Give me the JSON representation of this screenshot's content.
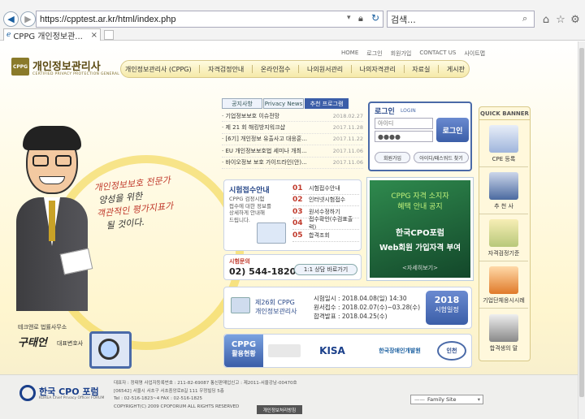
{
  "browser": {
    "url": "https://cpptest.ar.kr/html/index.php",
    "search_placeholder": "검색...",
    "tab_title": "CPPG 개인정보관..."
  },
  "header": {
    "logo_title": "개인정보관리사",
    "logo_sub": "CERTIFIED PRIVACY PROTECTION GENERAL",
    "logo_badge": "CPPG",
    "top_links": [
      "HOME",
      "로그인",
      "회원가입",
      "CONTACT US",
      "사이트맵"
    ],
    "gnb": [
      "개인정보관리사 (CPPG)",
      "자격검정안내",
      "온라인접수",
      "나의원서관리",
      "나의자격관리",
      "자료실",
      "게시판"
    ]
  },
  "news": {
    "tabs": [
      "공지사항",
      "Privacy News",
      "추천 프로그램"
    ],
    "items": [
      {
        "title": "· 기업정보보호 이슈전망",
        "date": "2018.02.27"
      },
      {
        "title": "· 제 21 회 해킹방지워크샵",
        "date": "2017.11.28"
      },
      {
        "title": "· [6기] 개인정보 유출사고 대응훈...",
        "date": "2017.11.22"
      },
      {
        "title": "· EU 개인정보보호법 세미나 개최...",
        "date": "2017.11.06"
      },
      {
        "title": "· 바이오정보 보호 가이드라인(안)...",
        "date": "2017.11.06"
      }
    ]
  },
  "login": {
    "title": "로그인",
    "title_en": "LOGIN",
    "id_placeholder": "아이디",
    "pw_value": "●●●●",
    "login_button": "로그인",
    "join_button": "회원가입",
    "find_button": "아이디/패스워드 찾기"
  },
  "quick": {
    "title": "QUICK BANNER",
    "items": [
      "CPE 등록",
      "추 천 사",
      "자격검정기준",
      "기업단체응시시례",
      "합격생의 말"
    ]
  },
  "exam": {
    "title": "시험접수안내",
    "desc": [
      "CPPG 검정시험",
      "접수에 대한 정보를",
      "상세하게 안내해",
      "드립니다."
    ],
    "steps": [
      {
        "num": "01",
        "label": "시험접수안내"
      },
      {
        "num": "02",
        "label": "인터넷시험접수"
      },
      {
        "num": "03",
        "label": "원서수정하기"
      },
      {
        "num": "04",
        "label": "접수확인(수검표출력)"
      },
      {
        "num": "05",
        "label": "합격조회"
      }
    ],
    "inquiry_label": "시험문의",
    "phone": "02) 544-1820",
    "consult_button": "1:1 상담 바로가기"
  },
  "promo": {
    "line1": "CPPG 자격 소지자",
    "line2": "혜택 안내 공지",
    "line3": "한국CPO포럼",
    "line4": "Web회원 가입자격 부여",
    "more": "<자세히보기>"
  },
  "schedule": {
    "exam_name_1": "제26회 CPPG",
    "exam_name_2": "개인정보관리사",
    "rows": [
      {
        "label": "시험일시 :",
        "value": "2018.04.08(일) 14:30"
      },
      {
        "label": "원서접수 :",
        "value": "2018.02.07(수)~03.28(수)"
      },
      {
        "label": "합격발표 :",
        "value": "2018.04.25(수)"
      }
    ],
    "badge_year": "2018",
    "badge_text": "시험일정"
  },
  "partners": {
    "title_1": "CPPG",
    "title_2": "활용현황",
    "logos": [
      "KISA",
      "한국장애인개발원",
      "인천"
    ]
  },
  "mascot": {
    "speech": [
      "개인정보보호 전문가",
      "양성을 위한",
      "객관적인 평가지표가",
      "될 것이다."
    ],
    "office": "테크앤로 법률사무소",
    "name": "구태언",
    "role": "대표변호사"
  },
  "footer": {
    "logo": "한국 CPO 포럼",
    "logo_sub": "KOREA Chief Privacy Officer FORUM",
    "lines": [
      "대표자 : 정태명   사업자등록번호 : 211-82-69087   통신판매업신고 : 제2011-서울강남-00470호",
      "[06542] 서울시 서초구 서초중앙로8길 111 우정빌딩 5층",
      "Tel : 02-516-1823~4  FAX : 02-516-1825",
      "COPYRIGHT(C) 2009 CPOFORUM ALL RIGHTS RESERVED"
    ],
    "privacy_button": "개인정보처리방침",
    "family_site": "Family Site"
  },
  "colors": {
    "accent": "#3b5ea8",
    "brand_yellow": "#f5e9a8",
    "promo_green": "#1f6a3c"
  }
}
